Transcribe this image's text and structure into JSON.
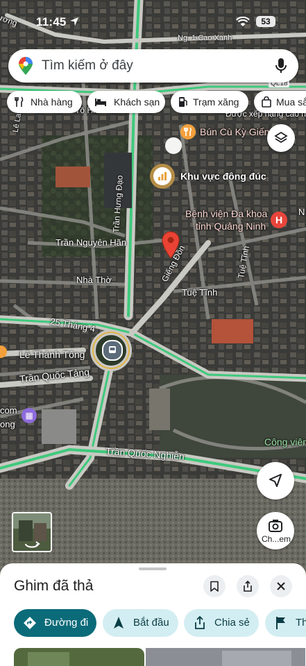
{
  "status_bar": {
    "time": "11:45",
    "battery": "53"
  },
  "search": {
    "placeholder": "Tìm kiếm ở đây"
  },
  "chips": [
    {
      "label": "Nhà hàng",
      "icon": "fork-knife-icon"
    },
    {
      "label": "Khách sạn",
      "icon": "bed-icon"
    },
    {
      "label": "Trạm xăng",
      "icon": "gas-station-icon"
    },
    {
      "label": "Mua sắ",
      "icon": "shopping-bag-icon"
    }
  ],
  "map_labels": {
    "ng_cao_xanh": "Ng. 1 Cao Xanh",
    "ql18": "QL18",
    "ranked": "Được xếp hạng cao nhất",
    "ho_hien_thanh": "Tô Hiến Thành",
    "le_lai": "Lê Lai",
    "bun": "Bún Cù Kỳ Giếng",
    "busy_area": "Khu vực đông đúc",
    "hospital_1": "Bệnh viện Đa khoa",
    "hospital_2": "tỉnh Quảng Ninh",
    "tran_hung_dao": "Trần Hưng Đạo",
    "tran_nguyen_han": "Trần Nguyên Hãn",
    "nha_tho": "Nhà Thờ",
    "gieng_don": "Giếng Đồn",
    "tue_tinh_v": "Tuệ Tĩnh",
    "tue_tinh": "Tuệ Tĩnh",
    "thang4": "25 Tháng 4",
    "le_thanh_tong": "Lê Thánh Tông",
    "tran_quoc_tang": "Trần Quốc Tảng",
    "com": "com",
    "ong": "ong",
    "cong_vien": "Công viên",
    "tran_quoc_nghien": "Trần Quốc Nghiễn",
    "n_edge": "N",
    "duong_edge": "ương"
  },
  "camera_label": "Ch...em",
  "sheet": {
    "title": "Ghim đã thả",
    "actions": [
      {
        "label": "Đường đi"
      },
      {
        "label": "Bắt đầu"
      },
      {
        "label": "Chia sẻ"
      },
      {
        "label": "Th"
      }
    ]
  },
  "colors": {
    "accent": "#0b57d0",
    "primary_button": "#0b6b79",
    "secondary_button": "#d3eef2",
    "pin": "#ea4335",
    "road_traffic": "#3fc97c"
  }
}
